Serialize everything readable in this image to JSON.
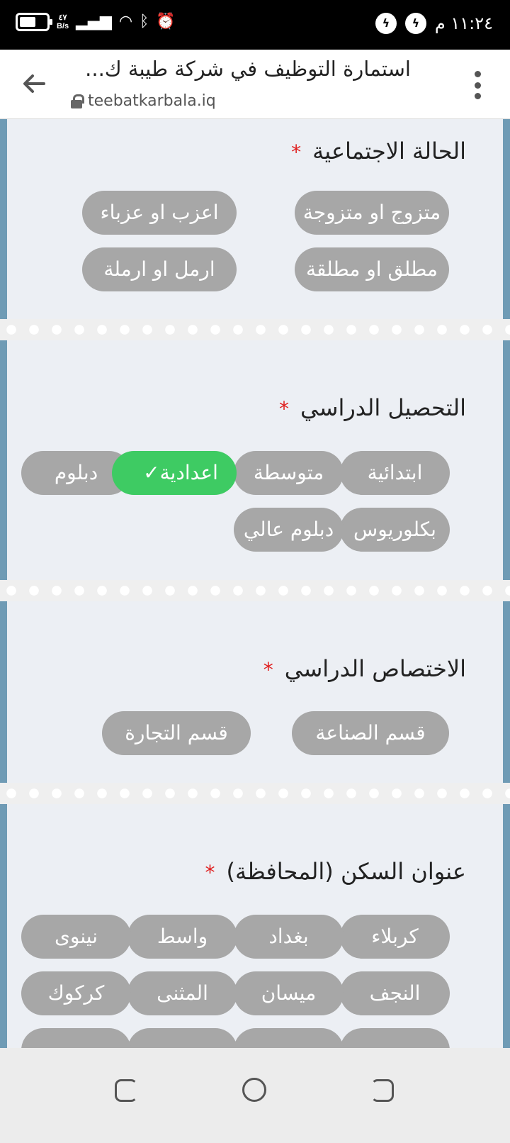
{
  "status_bar": {
    "net_speed_value": "٤٧",
    "net_speed_unit": "B/s",
    "clock": "١١:٢٤ م",
    "icons": [
      "battery-icon",
      "signal-icon",
      "wifi-icon",
      "bluetooth-icon",
      "alarm-icon",
      "messenger-icon"
    ]
  },
  "browser": {
    "title": "استمارة التوظيف في شركة طيبة ك...",
    "url": "teebatkarbala.iq"
  },
  "questions": [
    {
      "title": "الحالة الاجتماعية",
      "required": "*",
      "options": [
        "متزوج او متزوجة",
        "اعزب او عزباء",
        "مطلق او مطلقة",
        "ارمل او ارملة"
      ]
    },
    {
      "title": "التحصيل الدراسي",
      "required": "*",
      "options": [
        "ابتدائية",
        "متوسطة",
        "اعدادية",
        "دبلوم",
        "بكلوريوس",
        "دبلوم عالي"
      ],
      "selected": "اعدادية",
      "check": "✓"
    },
    {
      "title": "الاختصاص الدراسي",
      "required": "*",
      "options": [
        "قسم الصناعة",
        "قسم التجارة"
      ]
    },
    {
      "title": "عنوان السكن (المحافظة)",
      "required": "*",
      "options": [
        "كربلاء",
        "بغداد",
        "واسط",
        "نينوى",
        "النجف",
        "ميسان",
        "المثنى",
        "كركوك"
      ]
    }
  ],
  "colors": {
    "chip_default": "#a7a7a7",
    "chip_selected": "#3ecb63",
    "required_star": "#e02020",
    "side_border": "#6f9bb5"
  }
}
